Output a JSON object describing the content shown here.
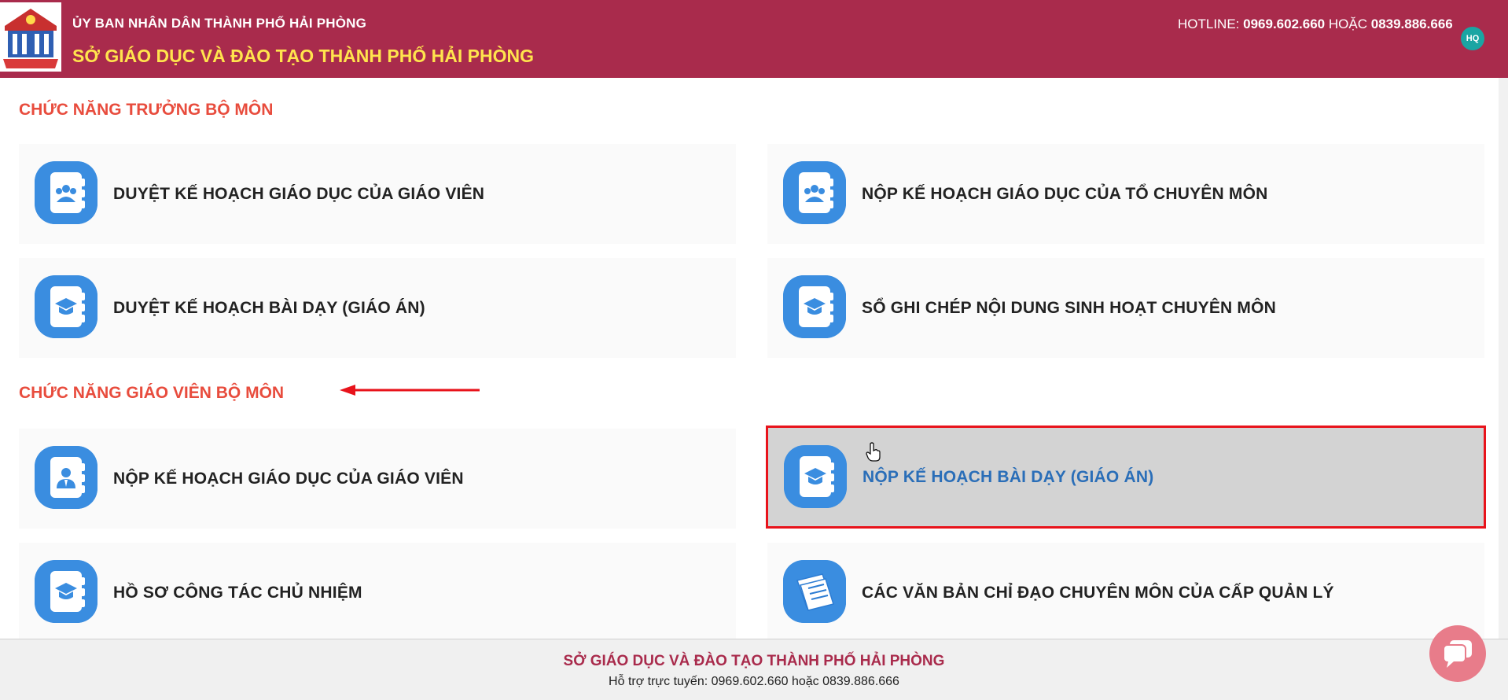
{
  "header": {
    "org": "ỦY BAN NHÂN DÂN THÀNH PHỐ HẢI PHÒNG",
    "dept": "SỞ GIÁO DỤC VÀ ĐÀO TẠO THÀNH PHỐ HẢI PHÒNG",
    "hotline_prefix": "HOTLINE:",
    "phone1": "0969.602.660",
    "or_word": "HOẶC",
    "phone2": "0839.886.666",
    "avatar": "HQ",
    "logo_icon": "school-logo-icon",
    "brand_color": "#a92b4c"
  },
  "sections": [
    {
      "title": "CHỨC NĂNG TRƯỞNG BỘ MÔN"
    },
    {
      "title": "CHỨC NĂNG GIÁO VIÊN BỘ MÔN"
    }
  ],
  "cards": [
    {
      "label": "DUYỆT KẾ HOẠCH GIÁO DỤC CỦA GIÁO VIÊN",
      "icon": "group-notebook-icon"
    },
    {
      "label": "NỘP KẾ HOẠCH GIÁO DỤC CỦA TỔ CHUYÊN MÔN",
      "icon": "group-notebook-icon"
    },
    {
      "label": "DUYỆT KẾ HOẠCH BÀI DẠY (GIÁO ÁN)",
      "icon": "graduation-notebook-icon"
    },
    {
      "label": "SỔ GHI CHÉP NỘI DUNG SINH HOẠT CHUYÊN MÔN",
      "icon": "graduation-notebook-icon"
    },
    {
      "label": "NỘP KẾ HOẠCH GIÁO DỤC CỦA GIÁO VIÊN",
      "icon": "teacher-notebook-icon"
    },
    {
      "label": "NỘP KẾ HOẠCH BÀI DẠY (GIÁO ÁN)",
      "icon": "graduation-notebook-icon",
      "highlighted": true
    },
    {
      "label": "HỒ SƠ CÔNG TÁC CHỦ NHIỆM",
      "icon": "graduation-notebook-icon"
    },
    {
      "label": "CÁC VĂN BẢN CHỈ ĐẠO CHUYÊN MÔN CỦA CẤP QUẢN LÝ",
      "icon": "documents-icon"
    }
  ],
  "footer": {
    "title": "SỞ GIÁO DỤC VÀ ĐÀO TẠO THÀNH PHỐ HẢI PHÒNG",
    "support": "Hỗ trợ trực tuyến: 0969.602.660 hoặc 0839.886.666"
  },
  "colors": {
    "section_title": "#e84c3d",
    "highlight_border": "#e8131b",
    "icon_bg": "#3a8de0"
  }
}
